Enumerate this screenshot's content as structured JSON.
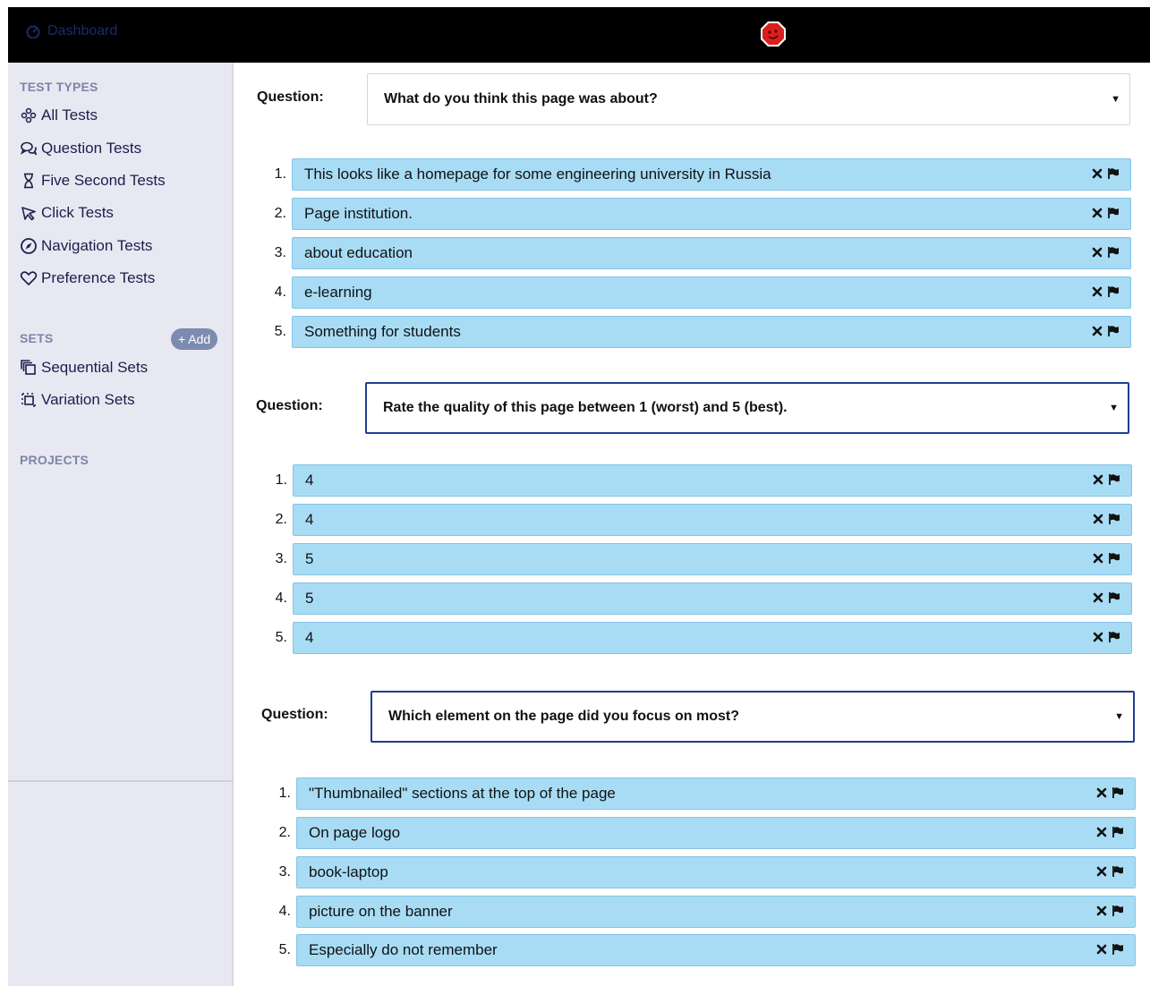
{
  "topbar": {
    "brand_label": "Dashboard"
  },
  "sidebar": {
    "test_types_heading": "TEST TYPES",
    "test_types": [
      {
        "label": "All Tests",
        "icon": "all-tests-icon"
      },
      {
        "label": "Question Tests",
        "icon": "question-bubbles-icon"
      },
      {
        "label": "Five Second Tests",
        "icon": "hourglass-icon"
      },
      {
        "label": "Click Tests",
        "icon": "cursor-icon"
      },
      {
        "label": "Navigation Tests",
        "icon": "compass-icon"
      },
      {
        "label": "Preference Tests",
        "icon": "heart-icon"
      }
    ],
    "sets_heading": "SETS",
    "add_label": "+ Add",
    "sets": [
      {
        "label": "Sequential Sets",
        "icon": "sequential-sets-icon"
      },
      {
        "label": "Variation Sets",
        "icon": "variation-sets-icon"
      }
    ],
    "projects_heading": "PROJECTS"
  },
  "questions": [
    {
      "label": "Question:",
      "text": "What do you think this page was about?",
      "answers": [
        {
          "num": "1.",
          "text": "This looks like a homepage for some engineering university in Russia"
        },
        {
          "num": "2.",
          "text": "Page institution."
        },
        {
          "num": "3.",
          "text": "about education"
        },
        {
          "num": "4.",
          "text": "e-learning"
        },
        {
          "num": "5.",
          "text": "Something for students"
        }
      ]
    },
    {
      "label": "Question:",
      "text": "Rate the quality of this page between 1 (worst) and 5 (best).",
      "answers": [
        {
          "num": "1.",
          "text": "4"
        },
        {
          "num": "2.",
          "text": "4"
        },
        {
          "num": "3.",
          "text": "5"
        },
        {
          "num": "4.",
          "text": "5"
        },
        {
          "num": "5.",
          "text": "4"
        }
      ]
    },
    {
      "label": "Question:",
      "text": "Which element on the page did you focus on most?",
      "answers": [
        {
          "num": "1.",
          "text": "\"Thumbnailed\" sections at the top of the page"
        },
        {
          "num": "2.",
          "text": "On page logo"
        },
        {
          "num": "3.",
          "text": "book-laptop"
        },
        {
          "num": "4.",
          "text": "picture on the banner"
        },
        {
          "num": "5.",
          "text": "Especially do not remember"
        }
      ]
    }
  ],
  "colors": {
    "topbar": "#000000",
    "sidebar": "#e8e8f2",
    "answer_fill": "#a8dcf5",
    "answer_border": "#84c3e6",
    "active_select_border": "#1d3d8f",
    "logo_red": "#d81f1f"
  }
}
